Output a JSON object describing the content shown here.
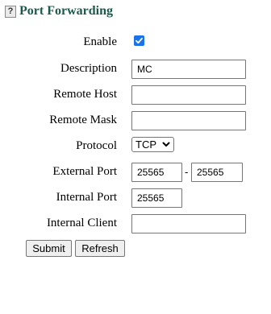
{
  "header": {
    "help_icon_glyph": "?",
    "title": "Port Forwarding"
  },
  "form": {
    "enable": {
      "label": "Enable",
      "checked": true
    },
    "description": {
      "label": "Description",
      "value": "MC"
    },
    "remote_host": {
      "label": "Remote Host",
      "value": ""
    },
    "remote_mask": {
      "label": "Remote Mask",
      "value": ""
    },
    "protocol": {
      "label": "Protocol",
      "value": "TCP"
    },
    "external_port": {
      "label": "External Port",
      "start": "25565",
      "separator": "-",
      "end": "25565"
    },
    "internal_port": {
      "label": "Internal Port",
      "value": "25565"
    },
    "internal_client": {
      "label": "Internal Client",
      "value": ""
    }
  },
  "actions": {
    "submit": "Submit",
    "refresh": "Refresh"
  },
  "colors": {
    "title": "#1b5a4a",
    "checkbox": "#1a73e8"
  }
}
